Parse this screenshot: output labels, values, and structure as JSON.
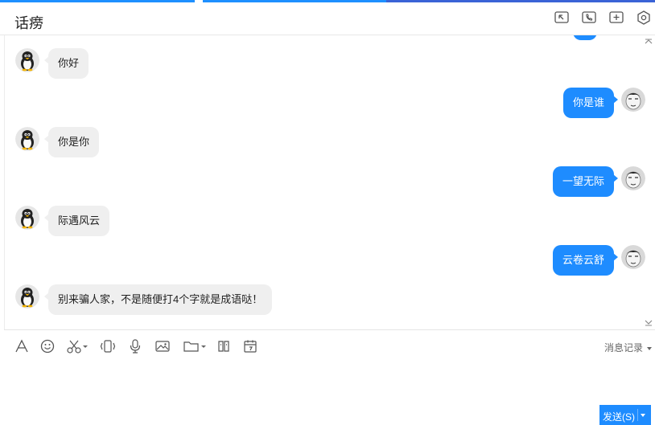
{
  "window": {
    "title": "话痨"
  },
  "colors": {
    "accent": "#1e8cff",
    "bubble_left": "#efefef",
    "bubble_right": "#1e8cff"
  },
  "header_icons": [
    "window-switch-icon",
    "phone-icon",
    "add-icon",
    "settings-icon"
  ],
  "messages": [
    {
      "side": "left",
      "text": "你好"
    },
    {
      "side": "right",
      "text": "你是谁"
    },
    {
      "side": "left",
      "text": "你是你"
    },
    {
      "side": "right",
      "text": "一望无际"
    },
    {
      "side": "left",
      "text": "际遇风云"
    },
    {
      "side": "right",
      "text": "云卷云舒"
    },
    {
      "side": "left",
      "text": "别来骗人家，不是随便打4个字就是成语哒！"
    }
  ],
  "toolbar": {
    "icons": [
      "font-icon",
      "emoji-icon",
      "scissors-icon",
      "shake-icon",
      "mic-icon",
      "image-icon",
      "folder-icon",
      "gift-icon",
      "calendar-icon"
    ],
    "history_label": "消息记录"
  },
  "input": {
    "value": ""
  },
  "send_button": {
    "label": "发送(S)"
  }
}
